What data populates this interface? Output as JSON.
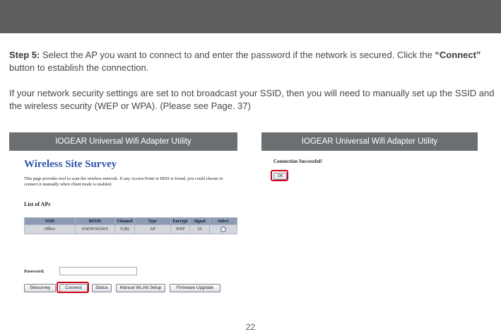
{
  "step": {
    "label": "Step 5:",
    "text_before": " Select the AP you want to connect to and enter the password if the network is secured. Click the ",
    "emphasis": "“Connect”",
    "text_after": " button to establish the connection."
  },
  "note": "If your network security settings are set to not broadcast your SSID, then you will need to manually set up the SSID and the wireless security (WEP or WPA). (Please see Page. 37)",
  "utility": {
    "app_title": "IOGEAR Universal Wifi Adapter Utility",
    "page_title": "Wireless Site Survey",
    "description": "This page provides tool to scan the wireless network. If any Access Point or IBSS is found, you could choose to connect it manually when client mode is enabled.",
    "list_title": "List of APs",
    "columns": [
      "SSID",
      "BSSID",
      "Channel",
      "Type",
      "Encrypt",
      "Signal",
      "Select"
    ],
    "rows": [
      {
        "ssid": "Office",
        "bssid": "0:0f:f0:50:b4:9",
        "channel": "9 (B)",
        "type": "AP",
        "encrypt": "WEP",
        "signal": "52"
      }
    ],
    "password_label": "Password:",
    "password_value": "",
    "buttons": {
      "sitesurvey": "Sitesurvey",
      "connect": "Connect",
      "status": "Status",
      "manual": "Manual WLAN Setup",
      "firmware": "Firmware Upgrade"
    }
  },
  "result": {
    "app_title": "IOGEAR Universal Wifi Adapter Utility",
    "message": "Connection Successful!",
    "ok": "OK"
  },
  "highlight_color": "#d0021b",
  "page_number": "22"
}
